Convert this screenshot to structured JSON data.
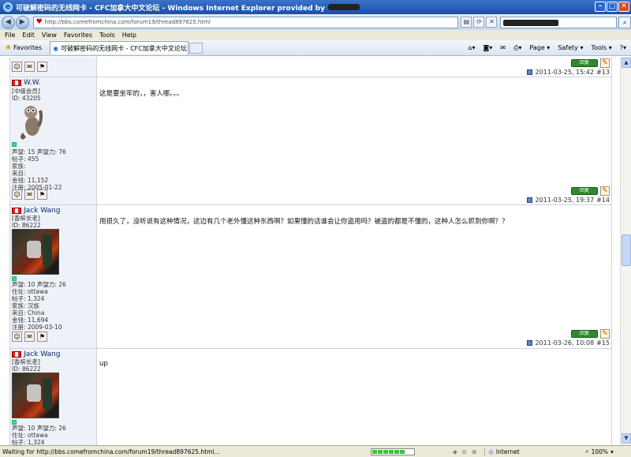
{
  "window": {
    "title": "可破解密码的无线网卡 - CFC加拿大中文论坛 - Windows Internet Explorer provided by"
  },
  "address": {
    "url": "http://bbs.comefromchina.com/forum19/thread897625.html"
  },
  "menu": [
    "File",
    "Edit",
    "View",
    "Favorites",
    "Tools",
    "Help"
  ],
  "favorites_label": "Favorites",
  "tab_title": "可破解密码的无线网卡 - CFC加拿大中文论坛",
  "commands": [
    "Page ▾",
    "Safety ▾",
    "Tools ▾"
  ],
  "posts": {
    "p13": {
      "date": "2011-03-25, 15:42",
      "num": "#13"
    },
    "p14": {
      "author": "W.W.",
      "rank": "[中级会员]",
      "id": "ID: 43205",
      "stats": [
        "声望: 15 声望力: 76",
        "帖子: 455",
        "家族:",
        "来自:",
        "金钱: 11,152",
        "注册: 2005-01-22"
      ],
      "message": "这是要坐牢的，，害人哪。。。",
      "date": "2011-03-25, 19:37",
      "num": "#14"
    },
    "p15": {
      "author": "Jack Wang",
      "rank": "[香槟长老]",
      "id": "ID: 86222",
      "stats": [
        "声望: 10 声望力: 26",
        "住址: ottawa",
        "帖子: 1,324",
        "家族: 汉族",
        "来自: China",
        "金钱: 11,694",
        "注册: 2009-03-10"
      ],
      "message": "用很久了，没听说有这种情况，这边有几个老外懂这种东西啊？如果懂的话谁会让你盗用吗？被盗的都是不懂的，这种人怎么抓到你啊？？",
      "date": "2011-03-26, 10:08",
      "num": "#15"
    },
    "p16": {
      "author": "Jack Wang",
      "rank": "[香槟长老]",
      "id": "ID: 86222",
      "stats": [
        "声望: 10 声望力: 26",
        "住址: ottawa",
        "帖子: 1,324"
      ],
      "message": "up"
    }
  },
  "status": {
    "text": "Waiting for http://bbs.comefromchina.com/forum19/thread897625.html...",
    "zone": "Internet",
    "zoom": "100%"
  }
}
